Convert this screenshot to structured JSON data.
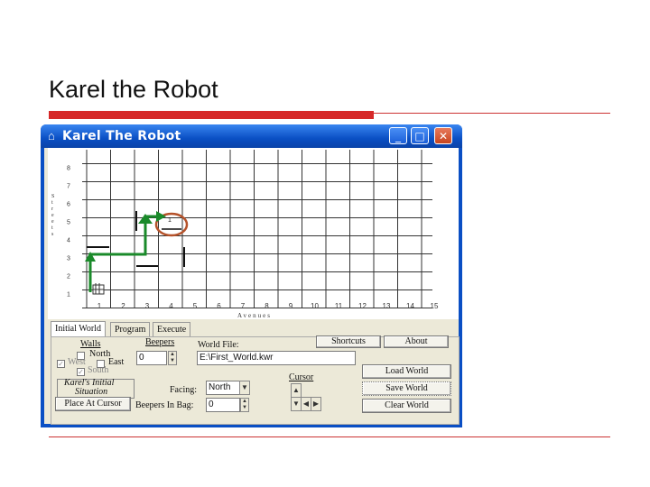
{
  "slide": {
    "title": "Karel the Robot"
  },
  "window": {
    "title": "Karel The Robot",
    "buttons": {
      "minimize": "_",
      "maximize": "□",
      "close": "✕"
    }
  },
  "world": {
    "street_numbers": [
      "8",
      "7",
      "6",
      "5",
      "4",
      "3",
      "2",
      "1"
    ],
    "avenue_numbers": [
      "1",
      "2",
      "3",
      "4",
      "5",
      "6",
      "7",
      "8",
      "9",
      "10",
      "11",
      "12",
      "13",
      "14",
      "15"
    ],
    "streets_label": "Streets",
    "avenues_label": "Avenues",
    "beeper_count": "1",
    "annotation_colors": {
      "path": "#1a8a2a",
      "circle": "#b5522a"
    }
  },
  "tabs": [
    "Initial World",
    "Program",
    "Execute"
  ],
  "panel": {
    "walls_label": "Walls",
    "north": "North",
    "west": "West",
    "east": "East",
    "south": "South",
    "beepers_label": "Beepers",
    "beepers_value": "0",
    "world_file_label": "World File:",
    "world_file_value": "E:\\First_World.kwr",
    "shortcuts_button": "Shortcuts",
    "about_button": "About",
    "load_world_button": "Load World",
    "save_world_button": "Save World",
    "clear_world_button": "Clear World",
    "karel_initial_line1": "Karel's Initial",
    "karel_initial_line2": "Situation",
    "place_at_cursor_button": "Place At Cursor",
    "facing_label": "Facing:",
    "facing_value": "North",
    "beepers_in_bag_label": "Beepers In Bag:",
    "beepers_in_bag_value": "0",
    "cursor_label": "Cursor"
  }
}
